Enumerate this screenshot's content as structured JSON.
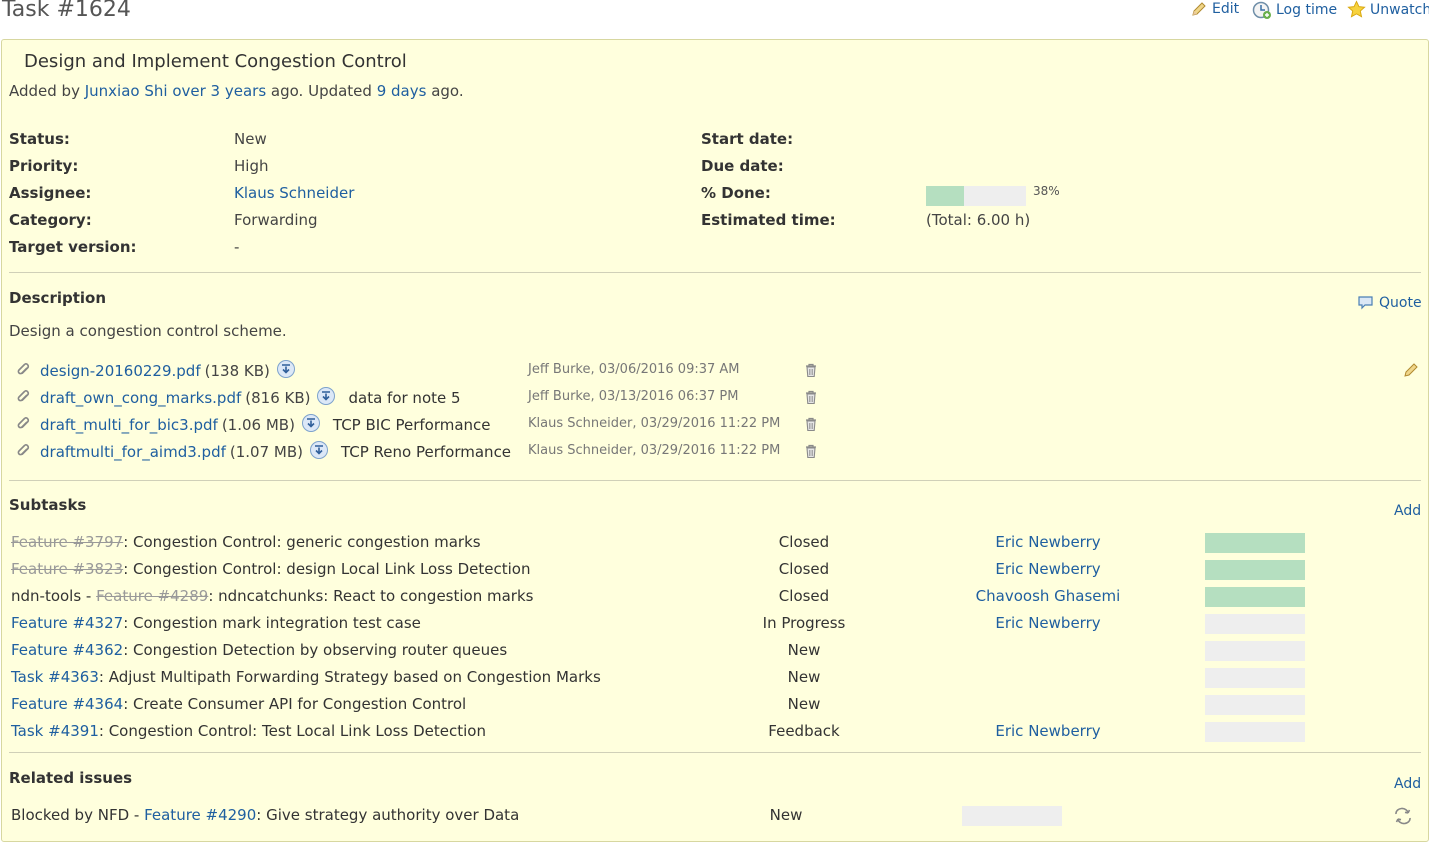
{
  "issue": {
    "title": "Task #1624",
    "subject": "Design and Implement Congestion Control",
    "author_prefix": "Added by ",
    "author": "Junxiao Shi",
    "created": "over 3 years",
    "updated_prefix": " ago. Updated ",
    "updated": "9 days",
    "updated_suffix": " ago."
  },
  "contextual": {
    "edit": "Edit",
    "log_time": "Log time",
    "unwatch": "Unwatch"
  },
  "attributes": {
    "status_label": "Status:",
    "status": "New",
    "priority_label": "Priority:",
    "priority": "High",
    "assignee_label": "Assignee:",
    "assignee": "Klaus Schneider",
    "category_label": "Category:",
    "category": "Forwarding",
    "target_label": "Target version:",
    "target": "-",
    "start_label": "Start date:",
    "start": "",
    "due_label": "Due date:",
    "due": "",
    "done_label": "% Done:",
    "done_text": "38%",
    "done_value": 0.38,
    "estimated_label": "Estimated time:",
    "estimated": "(Total: 6.00 h)"
  },
  "description": {
    "heading": "Description",
    "quote": "Quote",
    "text": "Design a congestion control scheme."
  },
  "attachments": [
    {
      "name": "design-20160229.pdf",
      "size": "(138 KB)",
      "desc": "",
      "meta": "Jeff Burke, 03/06/2016 09:37 AM"
    },
    {
      "name": "draft_own_cong_marks.pdf",
      "size": "(816 KB)",
      "desc": "data for note 5",
      "meta": "Jeff Burke, 03/13/2016 06:37 PM"
    },
    {
      "name": "draft_multi_for_bic3.pdf",
      "size": "(1.06 MB)",
      "desc": "TCP BIC Performance",
      "meta": "Klaus Schneider, 03/29/2016 11:22 PM"
    },
    {
      "name": "draftmulti_for_aimd3.pdf",
      "size": "(1.07 MB)",
      "desc": "TCP Reno Performance",
      "meta": "Klaus Schneider, 03/29/2016 11:22 PM"
    }
  ],
  "subtasks": {
    "heading": "Subtasks",
    "add": "Add",
    "rows": [
      {
        "prefix": "",
        "ref": "Feature #3797",
        "closed": true,
        "subject": ": Congestion Control: generic congestion marks",
        "status": "Closed",
        "assignee": "Eric Newberry",
        "done": 1.0
      },
      {
        "prefix": "",
        "ref": "Feature #3823",
        "closed": true,
        "subject": ": Congestion Control: design Local Link Loss Detection",
        "status": "Closed",
        "assignee": "Eric Newberry",
        "done": 1.0
      },
      {
        "prefix": "ndn-tools - ",
        "ref": "Feature #4289",
        "closed": true,
        "subject": ": ndncatchunks: React to congestion marks",
        "status": "Closed",
        "assignee": "Chavoosh Ghasemi",
        "done": 1.0
      },
      {
        "prefix": "",
        "ref": "Feature #4327",
        "closed": false,
        "subject": ": Congestion mark integration test case",
        "status": "In Progress",
        "assignee": "Eric Newberry",
        "done": 0
      },
      {
        "prefix": "",
        "ref": "Feature #4362",
        "closed": false,
        "subject": ": Congestion Detection by observing router queues",
        "status": "New",
        "assignee": "",
        "done": 0
      },
      {
        "prefix": "",
        "ref": "Task #4363",
        "closed": false,
        "subject": ": Adjust Multipath Forwarding Strategy based on Congestion Marks",
        "status": "New",
        "assignee": "",
        "done": 0
      },
      {
        "prefix": "",
        "ref": "Feature #4364",
        "closed": false,
        "subject": ": Create Consumer API for Congestion Control",
        "status": "New",
        "assignee": "",
        "done": 0
      },
      {
        "prefix": "",
        "ref": "Task #4391",
        "closed": false,
        "subject": ": Congestion Control: Test Local Link Loss Detection",
        "status": "Feedback",
        "assignee": "Eric Newberry",
        "done": 0
      }
    ]
  },
  "relations": {
    "heading": "Related issues",
    "add": "Add",
    "rows": [
      {
        "prefix": "Blocked by NFD - ",
        "ref": "Feature #4290",
        "subject": ": Give strategy authority over Data",
        "status": "New",
        "done": 0
      }
    ]
  }
}
